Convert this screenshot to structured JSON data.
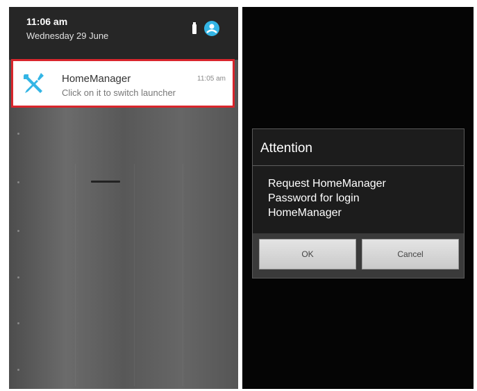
{
  "left_panel": {
    "status": {
      "time": "11:06 am",
      "date": "Wednesday 29 June"
    },
    "notification": {
      "app_name": "HomeManager",
      "text": "Click on it to switch launcher",
      "time": "11:05 am",
      "icon": "tools-icon",
      "highlight_color": "#d9262c",
      "icon_color": "#33b5e5"
    }
  },
  "right_panel": {
    "dialog": {
      "title": "Attention",
      "message_lines": [
        "Request HomeManager",
        "Password for login",
        "HomeManager"
      ],
      "ok_label": "OK",
      "cancel_label": "Cancel"
    }
  }
}
